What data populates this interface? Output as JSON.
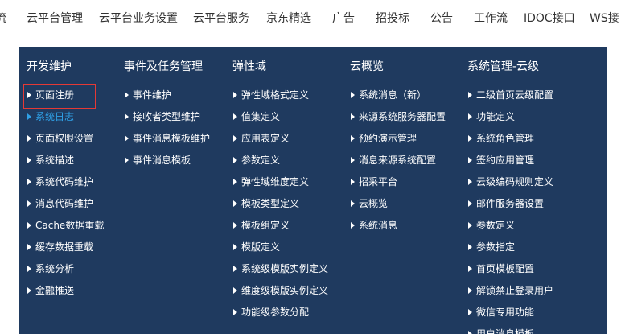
{
  "top_nav": {
    "items": [
      "流",
      "云平台管理",
      "云平台业务设置",
      "云平台服务",
      "京东精选",
      "广告",
      "招投标",
      "公告",
      "工作流",
      "IDOC接口",
      "WS接"
    ]
  },
  "menu": {
    "columns": [
      {
        "title": "开发维护",
        "items": [
          "页面注册",
          "系统日志",
          "页面权限设置",
          "系统描述",
          "系统代码维护",
          "消息代码维护",
          "Cache数据重载",
          "缓存数据重载",
          "系统分析",
          "金融推送"
        ]
      },
      {
        "title": "事件及任务管理",
        "items": [
          "事件维护",
          "接收者类型维护",
          "事件消息模板维护",
          "事件消息模板"
        ]
      },
      {
        "title": "弹性域",
        "items": [
          "弹性域格式定义",
          "值集定义",
          "应用表定义",
          "参数定义",
          "弹性域维度定义",
          "模板类型定义",
          "模板组定义",
          "模版定义",
          "系统级模版实例定义",
          "维度级模版实例定义",
          "功能级参数分配"
        ]
      },
      {
        "title": "云概览",
        "items": [
          "系统消息（新）",
          "来源系统服务器配置",
          "预约演示管理",
          "消息来源系统配置",
          "招采平台",
          "云概览",
          "系统消息"
        ]
      },
      {
        "title": "系统管理-云级",
        "items": [
          "二级首页云级配置",
          "功能定义",
          "系统角色管理",
          "签约应用管理",
          "云级编码规则定义",
          "邮件服务器设置",
          "参数定义",
          "参数指定",
          "首页模板配置",
          "解锁禁止登录用户",
          "微信专用功能",
          "用户消息模板"
        ]
      }
    ]
  },
  "colors": {
    "menu_background": "#1f3a5f",
    "menu_text": "#ffffff",
    "highlight_text": "#2fa0e6",
    "selected_border": "#e53935",
    "nav_text": "#333333"
  },
  "state": {
    "selected_item": "页面注册",
    "hover_item": "系统日志"
  }
}
